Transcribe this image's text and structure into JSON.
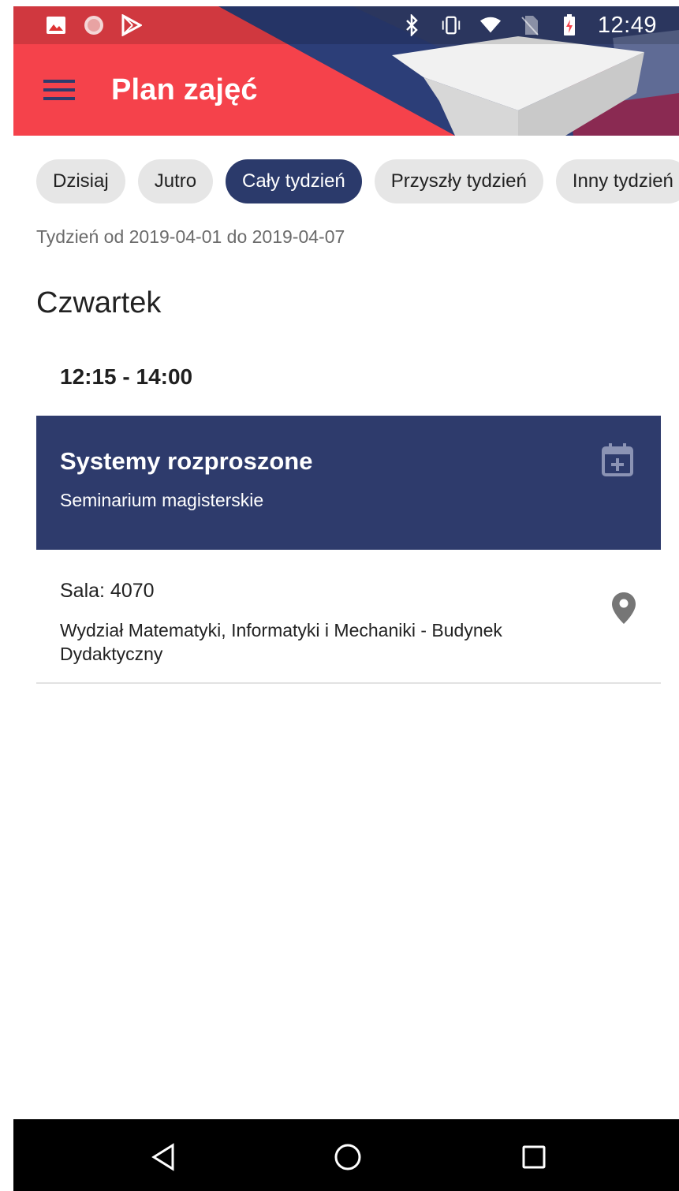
{
  "status_bar": {
    "time": "12:49",
    "left_icons": [
      "image-icon",
      "record-icon",
      "play-store-icon"
    ],
    "right_icons": [
      "bluetooth-icon",
      "vibrate-icon",
      "wifi-icon",
      "no-sim-icon",
      "battery-charging-icon"
    ]
  },
  "toolbar": {
    "title": "Plan zajęć",
    "menu_icon": "hamburger-menu-icon"
  },
  "chips": [
    {
      "label": "Dzisiaj",
      "active": false
    },
    {
      "label": "Jutro",
      "active": false
    },
    {
      "label": "Cały tydzień",
      "active": true
    },
    {
      "label": "Przyszły tydzień",
      "active": false
    },
    {
      "label": "Inny tydzień",
      "active": false
    }
  ],
  "week_range": "Tydzień od 2019-04-01 do 2019-04-07",
  "schedule": {
    "day": "Czwartek",
    "time": "12:15 - 14:00",
    "event": {
      "title": "Systemy rozproszone",
      "type": "Seminarium magisterskie",
      "room": "Sala: 4070",
      "building": "Wydział Matematyki, Informatyki i Mechaniki - Budynek Dydaktyczny",
      "add_icon": "calendar-add-icon",
      "location_icon": "location-pin-icon"
    }
  },
  "colors": {
    "header_red": "#f5424b",
    "navy": "#2e3b6c",
    "chip_gray": "#e6e6e6"
  },
  "nav_bar": {
    "icons": [
      "back-icon",
      "home-icon",
      "recents-icon"
    ]
  }
}
